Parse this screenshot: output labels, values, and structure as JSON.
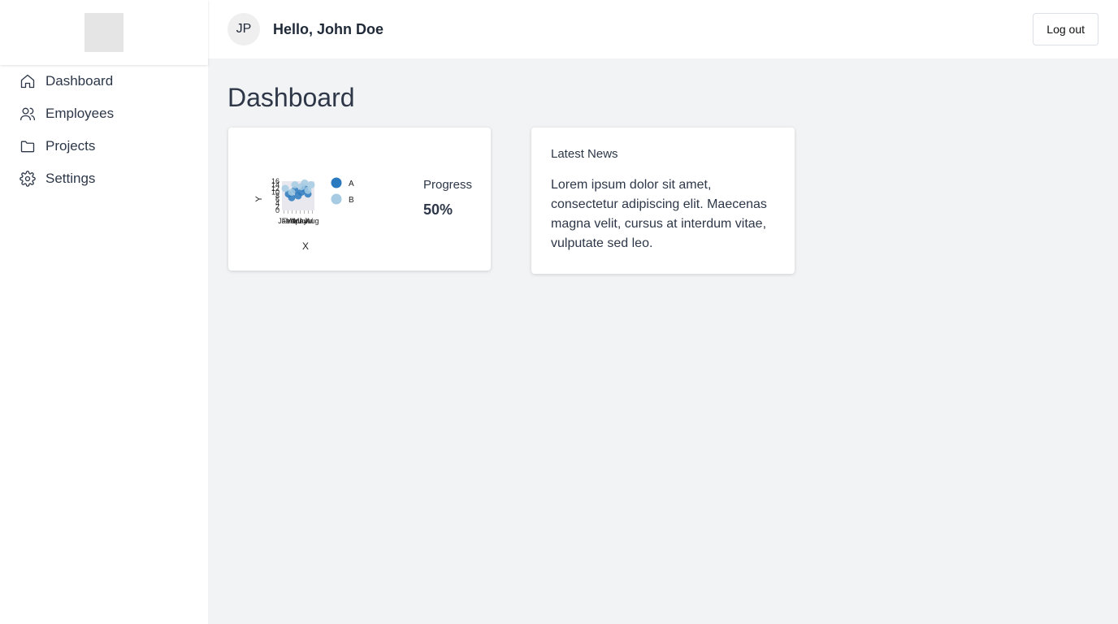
{
  "sidebar": {
    "items": [
      {
        "label": "Dashboard",
        "icon": "home-icon"
      },
      {
        "label": "Employees",
        "icon": "users-icon"
      },
      {
        "label": "Projects",
        "icon": "folder-icon"
      },
      {
        "label": "Settings",
        "icon": "gear-icon"
      }
    ]
  },
  "header": {
    "avatar_initials": "JP",
    "greeting": "Hello, John Doe",
    "logout_label": "Log out"
  },
  "main": {
    "title": "Dashboard",
    "progress": {
      "label": "Progress",
      "value": "50%",
      "fraction": 0.5
    },
    "news": {
      "title": "Latest News",
      "body": "Lorem ipsum dolor sit amet, consectetur adipiscing elit. Maecenas magna velit, cursus at interdum vitae, vulputate sed leo."
    }
  },
  "chart_data": {
    "type": "scatter",
    "xlabel": "X",
    "ylabel": "Y",
    "legend_position": "right",
    "series": [
      {
        "name": "A",
        "color": "#2b79be",
        "points": [
          [
            2,
            9
          ],
          [
            3,
            7
          ],
          [
            4,
            11
          ],
          [
            5,
            8
          ],
          [
            6,
            10
          ],
          [
            7,
            12
          ],
          [
            8,
            9
          ]
        ]
      },
      {
        "name": "B",
        "color": "#a6cbe3",
        "points": [
          [
            1,
            12
          ],
          [
            3,
            10
          ],
          [
            4,
            14
          ],
          [
            6,
            13
          ],
          [
            7,
            15
          ],
          [
            8,
            11
          ],
          [
            9,
            14
          ]
        ]
      }
    ],
    "ylim": [
      0,
      16
    ],
    "xlim": [
      0,
      10
    ],
    "yticks": [
      "0",
      "2",
      "4",
      "6",
      "8",
      "10",
      "12",
      "14",
      "16"
    ],
    "xticks": [
      "Jan",
      "Feb",
      "Mar",
      "Apr",
      "May",
      "Jun",
      "Jul",
      "Aug"
    ]
  }
}
